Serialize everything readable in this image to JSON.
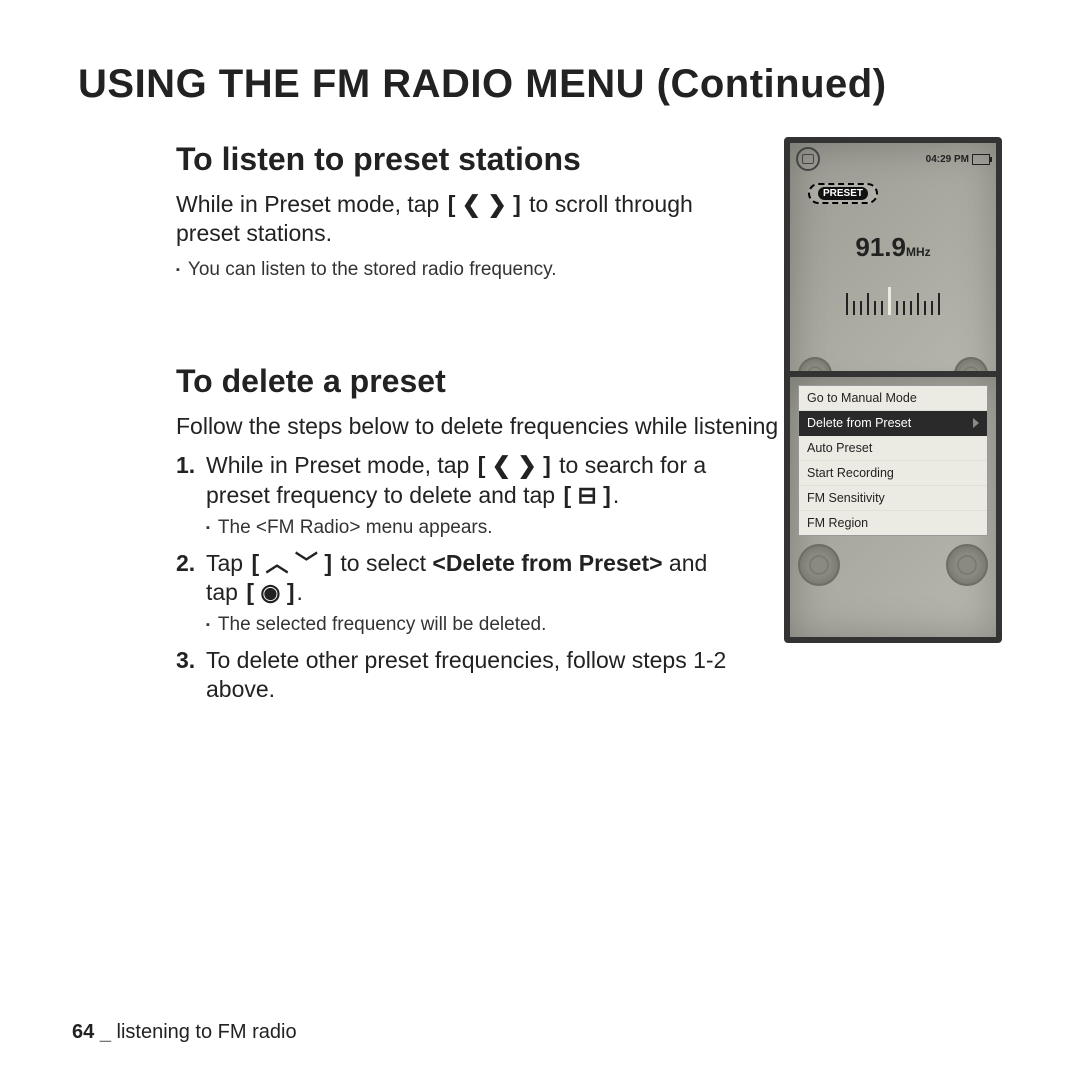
{
  "title": "USING THE FM RADIO MENU (Continued)",
  "section1": {
    "heading": "To listen to preset stations",
    "body_pre": "While in Preset mode, tap ",
    "body_key": "[ ❮  ❯ ]",
    "body_post": " to scroll through preset stations.",
    "bullet": "You can listen to the stored radio frequency."
  },
  "device1": {
    "time": "04:29 PM",
    "preset_label": "PRESET",
    "freq": "91.9",
    "unit": "MHz"
  },
  "section2": {
    "heading": "To delete a preset",
    "intro": "Follow the steps below to delete frequencies while listening to FM Radio.",
    "step1_pre": "While in Preset mode, tap ",
    "step1_key1": "[ ❮  ❯ ]",
    "step1_mid": " to search for a preset frequency to delete and tap ",
    "step1_key2": "[ ⊟ ]",
    "step1_end": ".",
    "step1_sub": "The <FM Radio> menu appears.",
    "step2_pre": "Tap ",
    "step2_key1": "[ ︿  ﹀ ]",
    "step2_mid": " to select ",
    "step2_bold": "<Delete from Preset>",
    "step2_mid2": " and tap ",
    "step2_key2": "[ ◉ ]",
    "step2_end": ".",
    "step2_sub": "The selected frequency will be deleted.",
    "step3": "To delete other preset frequencies, follow steps 1-2 above."
  },
  "device2": {
    "menu": [
      "Go to Manual Mode",
      "Delete from Preset",
      "Auto Preset",
      "Start Recording",
      "FM Sensitivity",
      "FM Region"
    ],
    "selected_index": 1
  },
  "footer": {
    "page": "64",
    "text": "listening to FM radio"
  }
}
